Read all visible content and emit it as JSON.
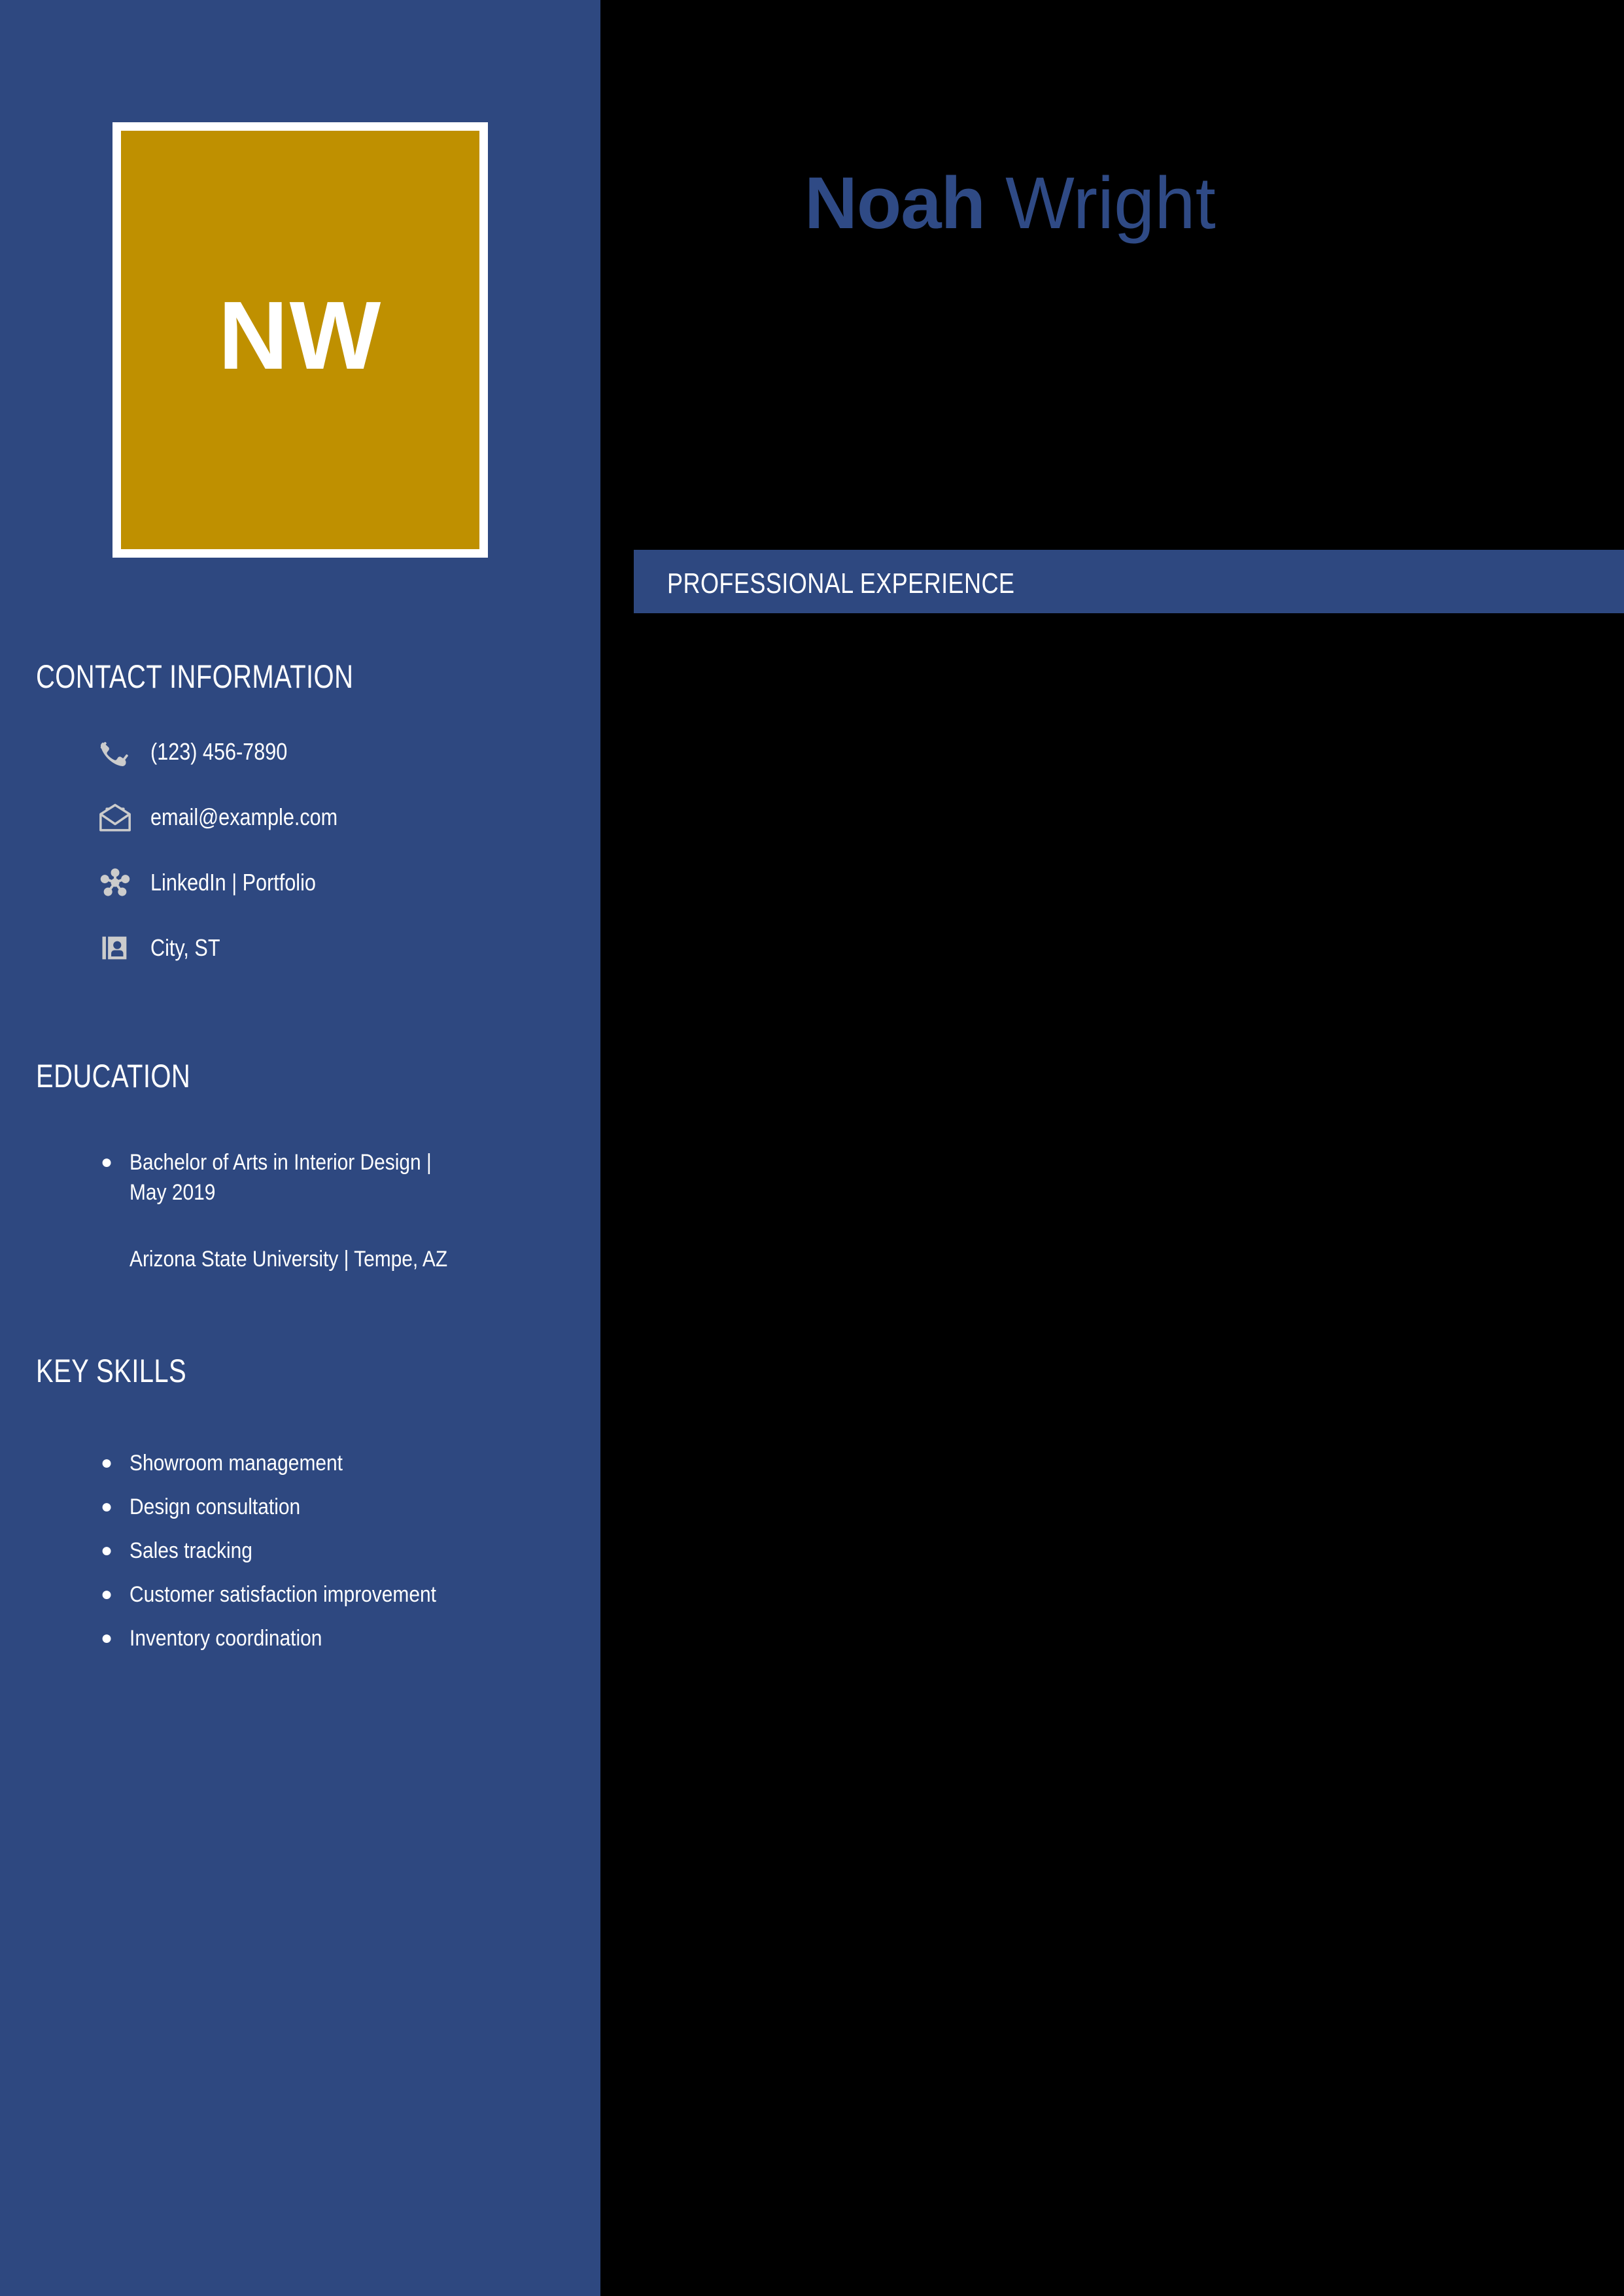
{
  "theme": {
    "sidebar_blue": "#2E4880",
    "accent_gold": "#BF9000",
    "name_blue": "#2F4A85",
    "panel_black": "#000000",
    "icon_gray": "#CCCCCC",
    "text_white": "#FFFFFF"
  },
  "sidebar": {
    "monogram": {
      "initials": "NW"
    },
    "contact": {
      "heading": "CONTACT INFORMATION",
      "items": [
        {
          "icon": "phone-icon",
          "text": "(123) 456-7890"
        },
        {
          "icon": "email-icon",
          "text": "email@example.com"
        },
        {
          "icon": "network-share-icon",
          "text": "LinkedIn | Portfolio"
        },
        {
          "icon": "contact-card-icon",
          "text": "City, ST"
        }
      ]
    },
    "education": {
      "heading": "EDUCATION",
      "bullets": [
        "Bachelor of Arts in Interior Design |\nMay 2019"
      ],
      "institution": "Arizona State University | Tempe, AZ"
    },
    "skills": {
      "heading": "KEY SKILLS",
      "bullets": [
        "Showroom management",
        "Design consultation",
        "Sales tracking",
        "Customer satisfaction improvement",
        "Inventory coordination"
      ]
    }
  },
  "main": {
    "name": {
      "first": "Noah",
      "last": " Wright"
    },
    "experience": {
      "heading": "PROFESSIONAL EXPERIENCE",
      "entries": []
    }
  }
}
